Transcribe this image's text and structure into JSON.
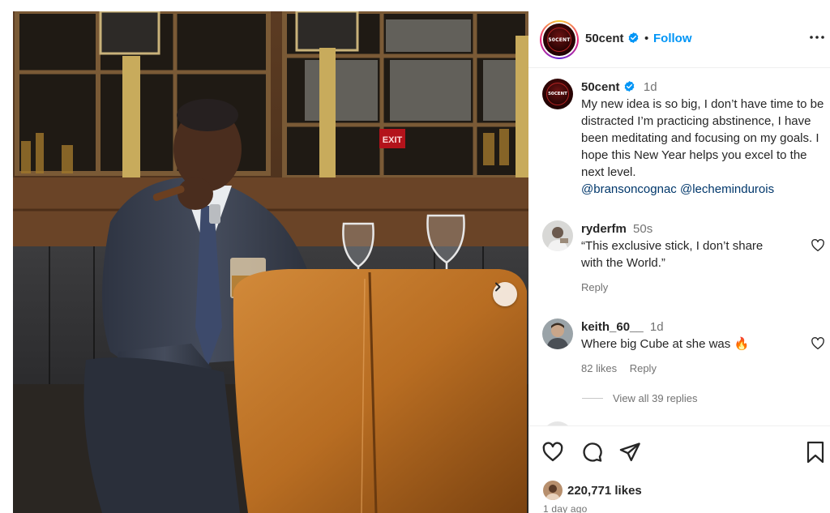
{
  "post": {
    "author": "50cent",
    "verified": true,
    "follow_label": "Follow",
    "separator": "•",
    "avatar_text": "50CENT",
    "caption": {
      "username": "50cent",
      "time": "1d",
      "text": "My new idea is so big, I don’t have time to be distracted I’m practicing abstinence, I have been meditating and focusing on my goals. I hope this New Year helps you excel to the next level.",
      "mentions": [
        "@bransoncognac",
        "@lechemindurois"
      ]
    },
    "photo": {
      "sign_text": "EXIT"
    },
    "comments": [
      {
        "username": "ryderfm",
        "time": "50s",
        "text": "“This exclusive stick, I don’t share with the World.”",
        "reply_label": "Reply",
        "likes_label": ""
      },
      {
        "username": "keith_60__",
        "time": "1d",
        "text": "Where big Cube at she was",
        "emoji": "🔥",
        "likes_label": "82 likes",
        "reply_label": "Reply"
      }
    ],
    "view_replies": "View all 39 replies",
    "likes_count": "220,771 likes",
    "posted_ago": "1 day ago"
  },
  "icons": {
    "verified": "verified-badge-icon",
    "more": "more-options-icon",
    "next": "chevron-right-icon",
    "like": "heart-icon",
    "comment": "comment-bubble-icon",
    "share": "paper-plane-icon",
    "save": "bookmark-icon"
  },
  "colors": {
    "accent": "#0095f6",
    "verified": "#0095f6",
    "muted": "#737373",
    "mention": "#00376b"
  }
}
